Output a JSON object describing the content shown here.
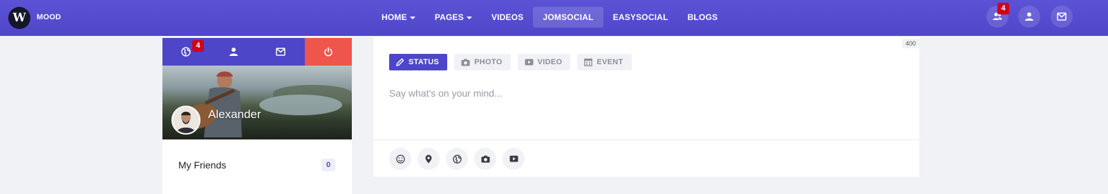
{
  "navbar": {
    "brand": "MOOD",
    "logo_letter": "W",
    "menu": [
      {
        "label": "HOME",
        "dropdown": true
      },
      {
        "label": "PAGES",
        "dropdown": true
      },
      {
        "label": "VIDEOS",
        "dropdown": false
      },
      {
        "label": "JOMSOCIAL",
        "dropdown": false,
        "active": true
      },
      {
        "label": "EASYSOCIAL",
        "dropdown": false
      },
      {
        "label": "BLOGS",
        "dropdown": false
      }
    ],
    "right_icons": [
      "users-icon",
      "user-icon",
      "mail-icon"
    ],
    "notification_count": "4"
  },
  "profile_card": {
    "tabs": [
      "globe-icon",
      "user-icon",
      "mail-icon",
      "power-icon"
    ],
    "globe_badge": "4",
    "username": "Alexander",
    "rows": [
      {
        "label": "My Friends",
        "count": "0"
      }
    ]
  },
  "composer": {
    "char_count": "400",
    "types": [
      {
        "label": "STATUS",
        "icon": "pencil-icon",
        "active": true
      },
      {
        "label": "PHOTO",
        "icon": "camera-icon",
        "active": false
      },
      {
        "label": "VIDEO",
        "icon": "video-icon",
        "active": false
      },
      {
        "label": "EVENT",
        "icon": "calendar-icon",
        "active": false
      }
    ],
    "placeholder": "Say what's on your mind...",
    "tools": [
      "smile-icon",
      "map-pin-icon",
      "globe-icon",
      "camera-icon",
      "video-icon"
    ]
  },
  "colors": {
    "navbar": "#5149cd",
    "accent": "#4d46c8",
    "danger": "#f0554b",
    "badge": "#d0021b"
  }
}
